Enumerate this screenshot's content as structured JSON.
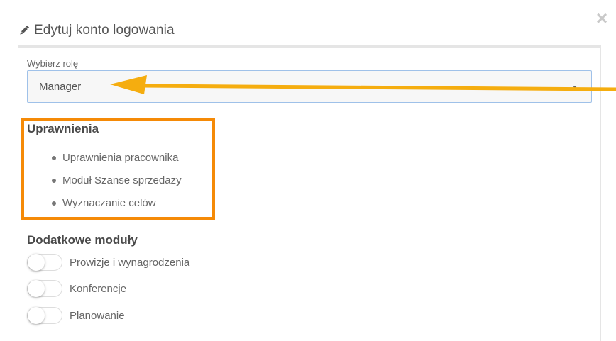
{
  "header": {
    "title": "Edytuj konto logowania",
    "close_symbol": "×"
  },
  "role": {
    "label": "Wybierz rolę",
    "selected": "Manager"
  },
  "permissions": {
    "heading": "Uprawnienia",
    "items": [
      "Uprawnienia pracownika",
      "Moduł Szanse sprzedazy",
      "Wyznaczanie celów"
    ]
  },
  "modules": {
    "heading": "Dodatkowe moduły",
    "toggles": [
      {
        "label": "Prowizje i wynagrodzenia",
        "enabled": false
      },
      {
        "label": "Konferencje",
        "enabled": false
      },
      {
        "label": "Planowanie",
        "enabled": false
      }
    ]
  },
  "icons": {
    "header": "pencil-icon",
    "close": "close-icon",
    "select": "chevron-down-icon"
  },
  "colors": {
    "annotation_arrow": "#f5ad0f",
    "highlight_box": "#f58a07",
    "select_border": "#9fc1e9"
  }
}
